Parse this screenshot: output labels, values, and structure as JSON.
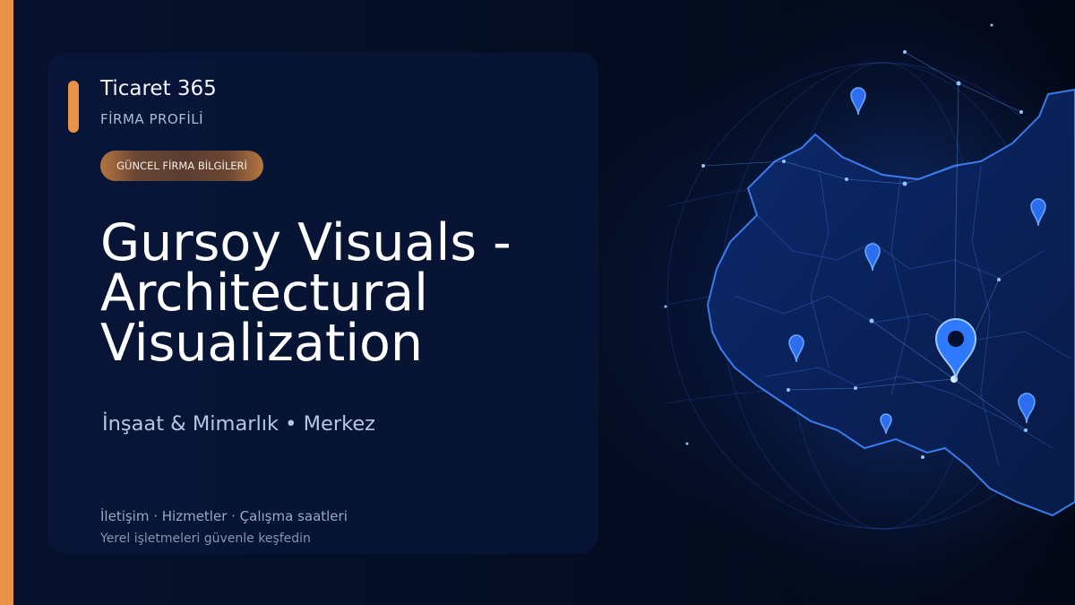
{
  "brand": {
    "name": "Ticaret 365",
    "subtitle": "FİRMA PROFİLİ",
    "accent_color": "#e8924a"
  },
  "badge": {
    "label": "GÜNCEL FİRMA BİLGİLERİ"
  },
  "business": {
    "title_lines": [
      "Gursoy Visuals -",
      "Architectural",
      "Visualization"
    ],
    "category": "İnşaat & Mimarlık • Merkez"
  },
  "footer": {
    "links": "İletişim · Hizmetler · Çalışma saatleri",
    "tagline": "Yerel işletmeleri güvenle keşfedin"
  },
  "map": {
    "image": "illustrated glowing map of Turkey with location pins",
    "glow_color": "#2a6cff",
    "pin_icon": "map-pin-icon"
  }
}
